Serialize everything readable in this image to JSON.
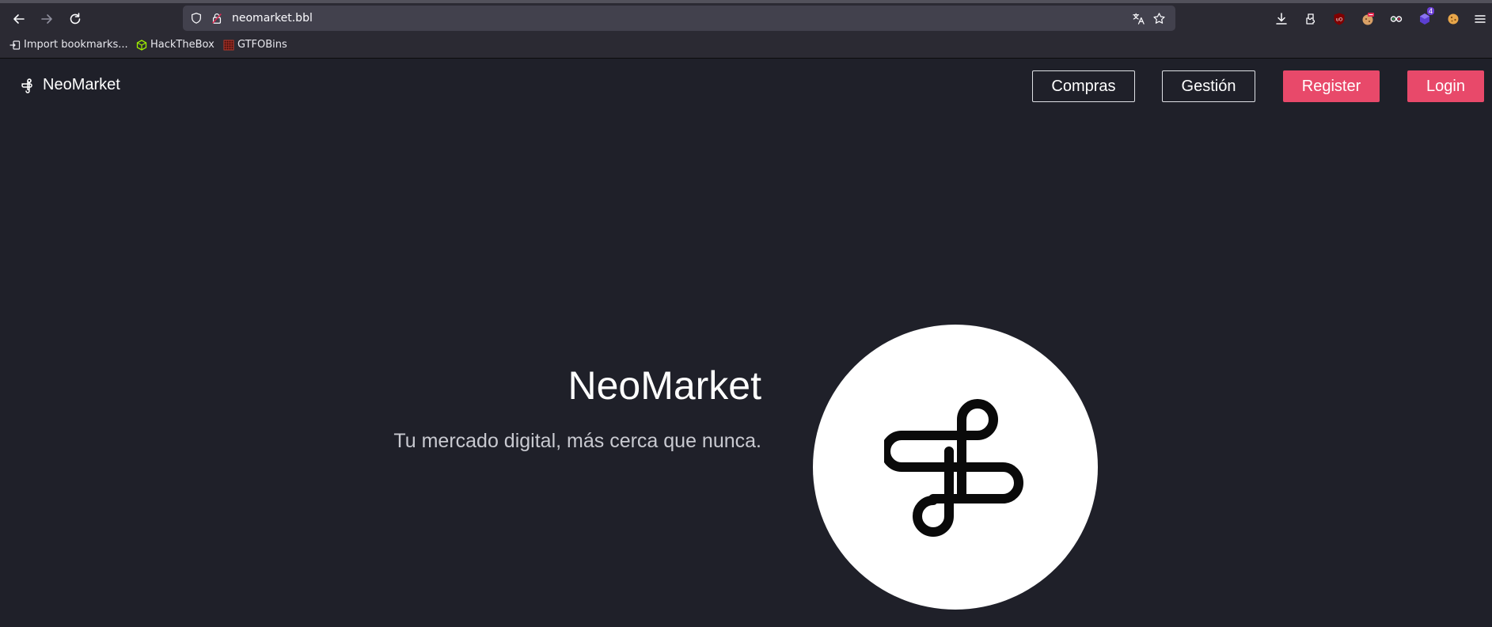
{
  "browser": {
    "url": "neomarket.bbl",
    "bookmarks": [
      {
        "label": "Import bookmarks..."
      },
      {
        "label": "HackTheBox"
      },
      {
        "label": "GTFOBins"
      }
    ],
    "extension_badge": "4",
    "icons": [
      "back-icon",
      "forward-icon",
      "reload-icon",
      "shield-icon",
      "lock-icon",
      "translate-icon",
      "star-icon",
      "download-icon",
      "extensions-icon",
      "ublock-icon",
      "cookie-editor-icon",
      "wappalyzer-icon",
      "foxyproxy-icon",
      "cookie-icon",
      "menu-icon"
    ]
  },
  "nav": {
    "brand": "NeoMarket",
    "buttons": {
      "compras": "Compras",
      "gestion": "Gestión",
      "register": "Register",
      "login": "Login"
    }
  },
  "hero": {
    "title": "NeoMarket",
    "subtitle": "Tu mercado digital, más cerca que nunca."
  },
  "colors": {
    "page_bg": "#1f2029",
    "accent": "#e8496a",
    "chrome_bg": "#2b2a33",
    "urlbar_bg": "#42414d"
  }
}
